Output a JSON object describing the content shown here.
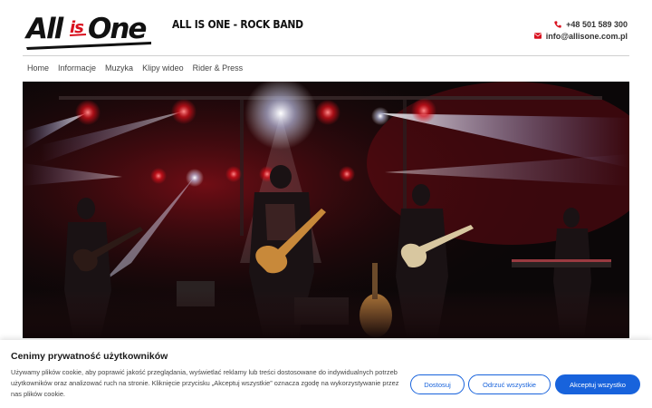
{
  "header": {
    "logo_text": "AllisOne",
    "band_name": "ALL IS ONE - ROCK BAND",
    "phone": "+48 501 589 300",
    "email": "info@allisone.com.pl"
  },
  "nav": {
    "items": [
      "Home",
      "Informacje",
      "Muzyka",
      "Klipy wideo",
      "Rider & Press"
    ]
  },
  "hero": {
    "image": "band-on-stage-photo"
  },
  "cookie_banner": {
    "title": "Cenimy prywatność użytkowników",
    "text": "Używamy plików cookie, aby poprawić jakość przeglądania, wyświetlać reklamy lub treści dostosowane do indywidualnych potrzeb użytkowników oraz analizować ruch na stronie. Kliknięcie przycisku „Akceptuj wszystkie” oznacza zgodę na wykorzystywanie przez nas plików cookie.",
    "customize_label": "Dostosuj",
    "reject_label": "Odrzuć wszystkie",
    "accept_label": "Akceptuj wszystko"
  },
  "colors": {
    "accent": "#1863dc",
    "logo_red": "#d9101e",
    "icon_red": "#d9101e"
  }
}
